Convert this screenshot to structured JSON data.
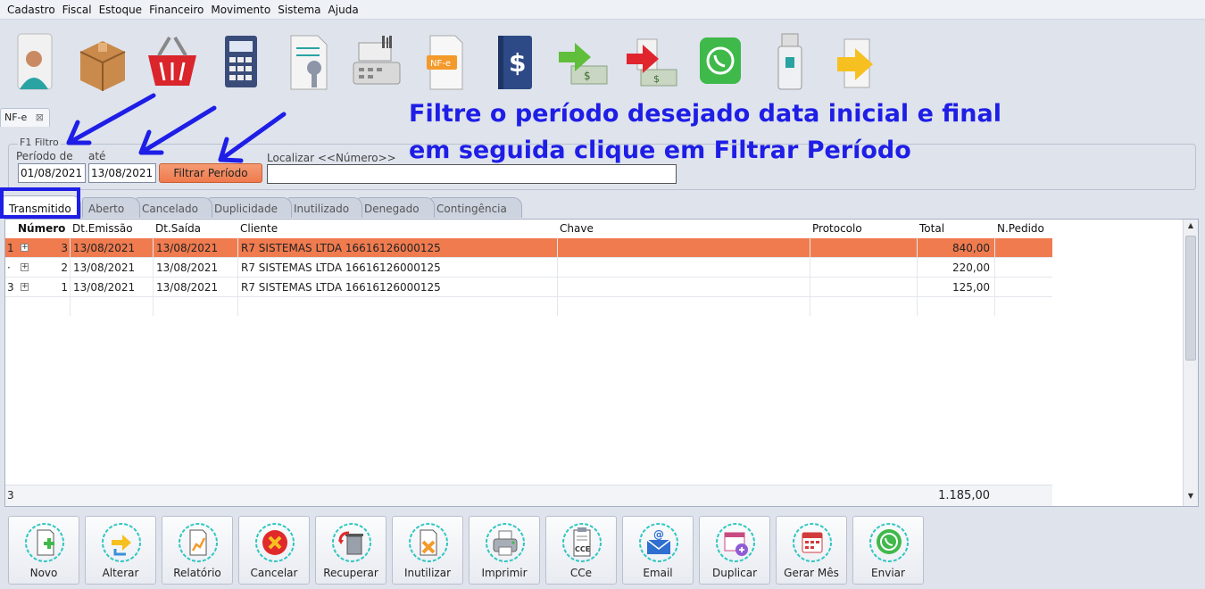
{
  "menu": [
    "Cadastro",
    "Fiscal",
    "Estoque",
    "Financeiro",
    "Movimento",
    "Sistema",
    "Ajuda"
  ],
  "toolbar_icons": [
    "person-icon",
    "box-icon",
    "basket-icon",
    "calculator-icon",
    "document-key-icon",
    "cash-register-icon",
    "nfe-document-icon",
    "money-book-icon",
    "money-in-icon",
    "money-out-icon",
    "whatsapp-icon",
    "usb-drive-icon",
    "export-icon"
  ],
  "document_tab": {
    "label": "NF-e",
    "close": "⊠"
  },
  "filter": {
    "legend": "F1 Filtro",
    "from_label": "Período de",
    "to_label": "até",
    "from_value": "01/08/2021",
    "to_value": "13/08/2021",
    "button_label": "Filtrar Período",
    "search_label": "Localizar <<Número>>",
    "search_value": ""
  },
  "tabs": [
    "Transmitido",
    "Aberto",
    "Cancelado",
    "Duplicidade",
    "Inutilizado",
    "Denegado",
    "Contingência"
  ],
  "grid": {
    "columns": [
      "Número",
      "Dt.Emissão",
      "Dt.Saída",
      "Cliente",
      "Chave",
      "Protocolo",
      "Total",
      "N.Pedido"
    ],
    "rows": [
      {
        "rownum": "1",
        "numero": "3",
        "emissao": "13/08/2021",
        "saida": "13/08/2021",
        "cliente": "R7 SISTEMAS LTDA 16616126000125",
        "chave": "",
        "protocolo": "",
        "total": "840,00",
        "pedido": ""
      },
      {
        "rownum": "·",
        "numero": "2",
        "emissao": "13/08/2021",
        "saida": "13/08/2021",
        "cliente": "R7 SISTEMAS LTDA 16616126000125",
        "chave": "",
        "protocolo": "",
        "total": "220,00",
        "pedido": ""
      },
      {
        "rownum": "3",
        "numero": "1",
        "emissao": "13/08/2021",
        "saida": "13/08/2021",
        "cliente": "R7 SISTEMAS LTDA 16616126000125",
        "chave": "",
        "protocolo": "",
        "total": "125,00",
        "pedido": ""
      }
    ],
    "footer": {
      "count": "3",
      "total": "1.185,00"
    }
  },
  "buttons": [
    {
      "label": "Novo",
      "icon": "new-document-icon"
    },
    {
      "label": "Alterar",
      "icon": "edit-arrows-icon"
    },
    {
      "label": "Relatório",
      "icon": "report-chart-icon"
    },
    {
      "label": "Cancelar",
      "icon": "cancel-x-icon"
    },
    {
      "label": "Recuperar",
      "icon": "recover-trash-icon"
    },
    {
      "label": "Inutilizar",
      "icon": "invalidate-document-icon"
    },
    {
      "label": "Imprimir",
      "icon": "printer-icon"
    },
    {
      "label": "CCe",
      "icon": "cce-document-icon"
    },
    {
      "label": "Email",
      "icon": "email-icon"
    },
    {
      "label": "Duplicar",
      "icon": "duplicate-calendar-icon"
    },
    {
      "label": "Gerar Mês",
      "icon": "calendar-icon"
    },
    {
      "label": "Enviar",
      "icon": "whatsapp-send-icon"
    }
  ],
  "annotation": {
    "line1": "Filtre o período desejado data inicial e final",
    "line2": "em seguida clique em Filtrar Período"
  },
  "colors": {
    "accent": "#ef7b4f",
    "annotation": "#1e1ee6",
    "background": "#dfe3ec"
  }
}
